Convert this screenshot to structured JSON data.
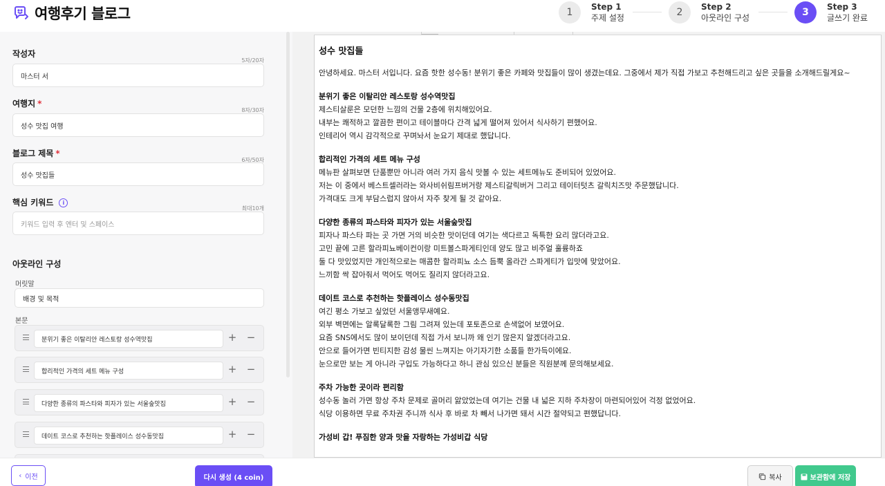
{
  "app": {
    "title": "여행후기 블로그",
    "logo_icon": "chat-smile-icon",
    "accent": "#6a4ef5"
  },
  "steps": [
    {
      "number": "1",
      "title": "Step 1",
      "desc": "주제 설정",
      "active": false
    },
    {
      "number": "2",
      "title": "Step 2",
      "desc": "아웃라인 구성",
      "active": false
    },
    {
      "number": "3",
      "title": "Step 3",
      "desc": "글쓰기 완료",
      "active": true
    }
  ],
  "form": {
    "author": {
      "label": "작성자",
      "counter": "5자/20자",
      "value": "마스터 서"
    },
    "destination": {
      "label": "여행지",
      "required": "*",
      "counter": "8자/30자",
      "value": "성수 맛집 여행"
    },
    "blog_title": {
      "label": "블로그 제목",
      "required": "*",
      "counter": "6자/50자",
      "value": "성수 맛집들"
    },
    "keywords": {
      "label": "핵심 키워드",
      "info_icon": "info-icon",
      "info_glyph": "i",
      "counter": "최대10개",
      "placeholder": "키워드 입력 후 엔터 및 스페이스"
    }
  },
  "outline": {
    "title": "아웃라인 구성",
    "head_label": "머릿말",
    "head_value": "배경 및 목적",
    "body_label": "본문",
    "rows": [
      "분위기 좋은 이탈리안 레스토랑 성수역맛집",
      "합리적인 가격의 세트 메뉴 구성",
      "다양한 종류의 파스타와 피자가 있는 서울숲맛집",
      "데이트 코스로 추천하는 핫플레이스 성수동맛집"
    ],
    "plus": "+",
    "minus": "−"
  },
  "document": {
    "title": "성수 맛집들",
    "intro": "안녕하세요. 마스터 서입니다. 요즘 핫한 성수동! 분위기 좋은 카페와 맛집들이 많이 생겼는데요. 그중에서 제가 직접 가보고 추천해드리고 싶은 곳들을 소개해드릴게요~",
    "sections": [
      {
        "heading": "분위기 좋은 이탈리안 레스토랑 성수역맛집",
        "lines": [
          "제스티살룬은 모던한 느낌의 건물 2층에 위치해있어요.",
          "내부는 쾌적하고 깔끔한 편이고 테이블마다 간격 넓게 떨어져 있어서 식사하기 편했어요.",
          "인테리어 역시 감각적으로 꾸며놔서 눈요기 제대로 했답니다."
        ]
      },
      {
        "heading": "합리적인 가격의 세트 메뉴 구성",
        "lines": [
          "메뉴판 살펴보면 단품뿐만 아니라 여러 가지 음식 맛볼 수 있는 세트메뉴도 준비되어 있었어요.",
          "저는 이 중에서 베스트셀러라는 와사비쉬림프버거랑 제스티갈릭버거 그리고 테이터텃츠 갈릭치즈맛 주문했답니다.",
          "가격대도 크게 부담스럽지 않아서 자주 찾게 될 것 같아요."
        ]
      },
      {
        "heading": "다양한 종류의 파스타와 피자가 있는 서울숲맛집",
        "lines": [
          "피자나 파스타 파는 곳 가면 거의 비슷한 맛이던데 여기는 색다르고 독특한 요리 많더라고요.",
          "고민 끝에 고른 할라피뇨베이컨이랑 미트볼스파게티인데 양도 많고 비주얼 훌륭하죠",
          "둘 다 맛있었지만 개인적으로는 매콤한 할라피뇨 소스 듬뿍 올라간 스파게티가 입맛에 맞았어요.",
          "느끼함 싹 잡아줘서 먹어도 먹어도 질리지 않더라고요."
        ]
      },
      {
        "heading": "데이트 코스로 추천하는 핫플레이스 성수동맛집",
        "lines": [
          "여긴 평소 가보고 싶었던 서울앵무새예요.",
          "외부 벽면에는 알록달록한 그림 그려져 있는데 포토존으로 손색없어 보였어요.",
          "요즘 SNS에서도 많이 보이던데 직접 가서 보니까 왜 인기 많은지 알겠더라고요.",
          "안으로 들어가면 빈티지한 감성 물씬 느껴지는 아기자기한 소품들 한가득이에요.",
          "눈으로만 보는 게 아니라 구입도 가능하다고 하니 관심 있으신 분들은 직원분께 문의해보세요."
        ]
      },
      {
        "heading": "주차 가능한 곳이라 편리함",
        "lines": [
          "성수동 놀러 가면 항상 주차 문제로 골머리 앓았었는데 여기는 건물 내 넓은 지하 주차장이 마련되어있어 걱정 없었어요.",
          "식당 이용하면 무료 주차권 주니까 식사 후 바로 차 빼서 나가면 돼서 시간 절약되고 편했답니다."
        ]
      },
      {
        "heading": "가성비 갑! 푸짐한 양과 맛을 자랑하는 가성비갑 식당",
        "lines": []
      }
    ]
  },
  "footer": {
    "prev_icon": "chevron-left-icon",
    "prev_glyph": "‹",
    "prev_label": "이전",
    "regen_label": "다시 생성 (4 coin)",
    "copy_icon": "copy-icon",
    "copy_label": "복사",
    "save_icon": "save-icon",
    "save_label": "보관함에 저장",
    "save_color": "#41c98d"
  }
}
